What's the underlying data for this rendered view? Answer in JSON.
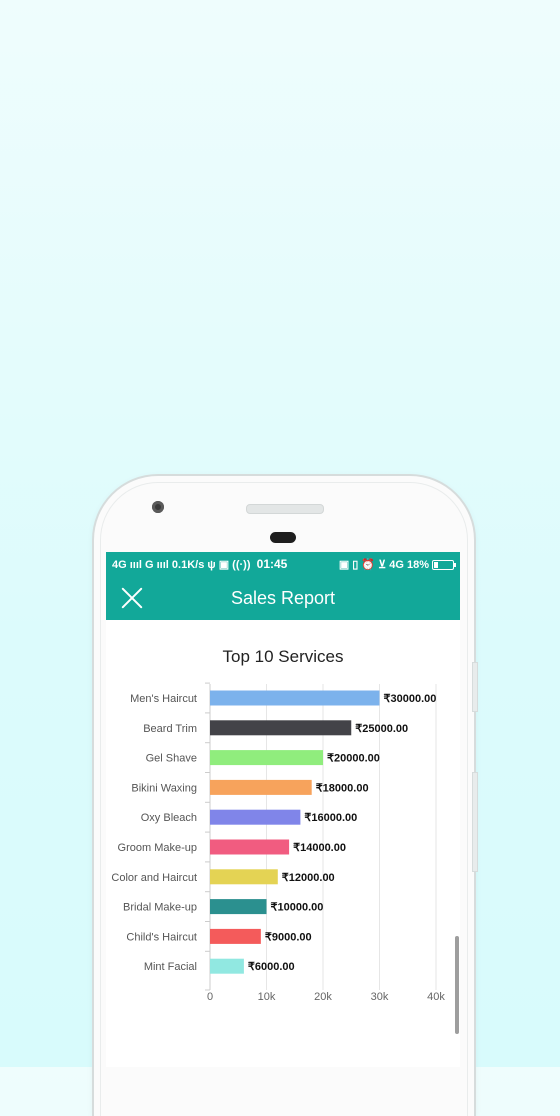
{
  "status_bar": {
    "left": "4G ıııl G ıııl 0.1K/s ψ ▣ ((·))",
    "time": "01:45",
    "right": "▣ ▯ ⏰ ⊻ 4G 18%"
  },
  "appbar": {
    "title": "Sales Report",
    "close_icon": "close-icon"
  },
  "colors": {
    "brand": "#12a899",
    "bars": [
      "#7cb2ec",
      "#434348",
      "#90ed7d",
      "#f7a35c",
      "#8085e9",
      "#f15c80",
      "#e4d354",
      "#2b908f",
      "#f45b5b",
      "#91e8e1"
    ]
  },
  "chart_data": {
    "type": "bar",
    "orientation": "horizontal",
    "title": "Top 10 Services",
    "categories": [
      "Men's Haircut",
      "Beard Trim",
      "Gel Shave",
      "Bikini Waxing",
      "Oxy Bleach",
      "Groom Make-up",
      "Color and Haircut",
      "Bridal Make-up",
      "Child's Haircut",
      "Mint Facial"
    ],
    "values": [
      30000,
      25000,
      20000,
      18000,
      16000,
      14000,
      12000,
      10000,
      9000,
      6000
    ],
    "value_labels": [
      "₹30000.00",
      "₹25000.00",
      "₹20000.00",
      "₹18000.00",
      "₹16000.00",
      "₹14000.00",
      "₹12000.00",
      "₹10000.00",
      "₹9000.00",
      "₹6000.00"
    ],
    "x_ticks": [
      0,
      10000,
      20000,
      30000,
      40000
    ],
    "x_tick_labels": [
      "0",
      "10k",
      "20k",
      "30k",
      "40k"
    ],
    "xlim": [
      0,
      40000
    ],
    "grid": true
  }
}
